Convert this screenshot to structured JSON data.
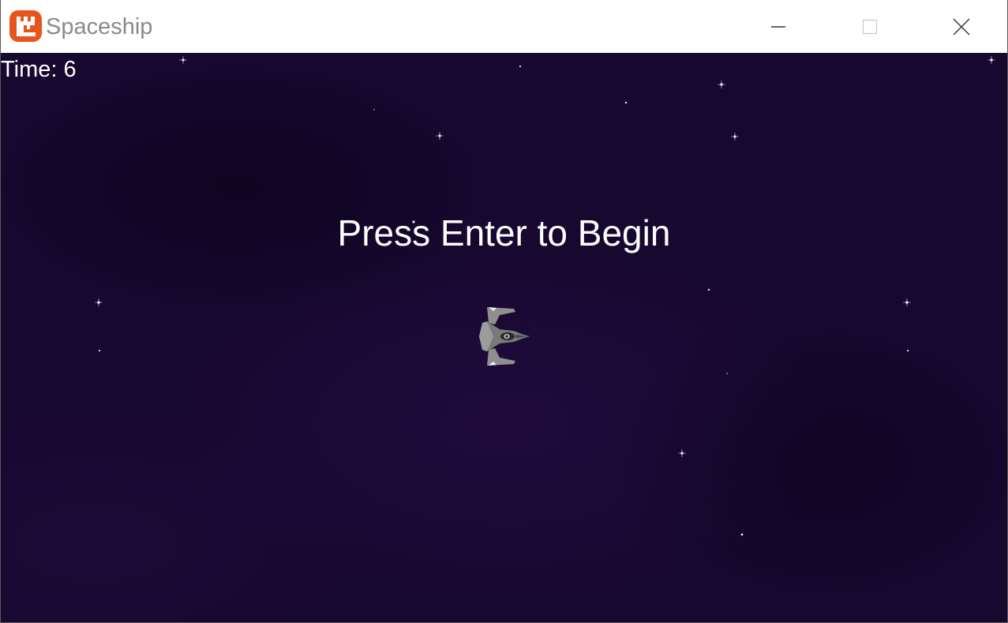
{
  "window": {
    "title": "Spaceship",
    "logo_icon": "monogame-logo-icon",
    "controls": {
      "minimize_icon": "minimize-icon",
      "maximize_icon": "maximize-icon",
      "close_icon": "close-icon"
    }
  },
  "game": {
    "timer": {
      "label": "Time:",
      "value": "6"
    },
    "prompt": "Press Enter to Begin",
    "player_icon": "spaceship-icon"
  },
  "colors": {
    "logo": "#e8541b",
    "background": "#170830",
    "text": "#ffffff",
    "title_text": "#8a8a8a"
  }
}
